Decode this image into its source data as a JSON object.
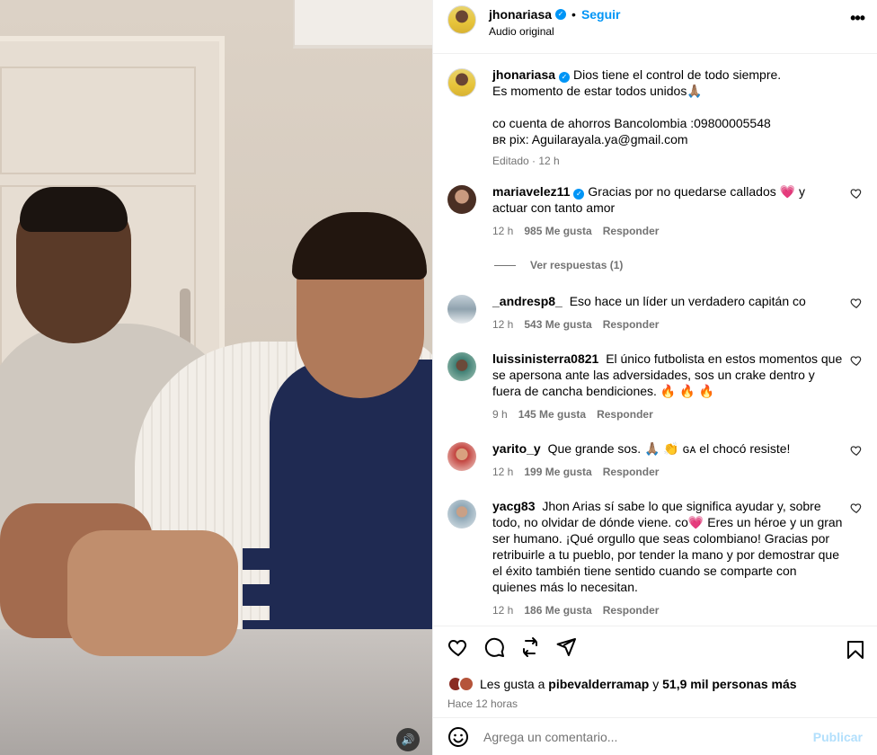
{
  "header": {
    "username": "jhonariasa",
    "separator": "•",
    "follow_label": "Seguir",
    "audio_label": "Audio original",
    "more_label": "•••"
  },
  "caption": {
    "username": "jhonariasa",
    "lines": [
      "Dios tiene el control de todo siempre.",
      "Es momento de estar todos unidos🙏🏽",
      "",
      "co cuenta de ahorros Bancolombia :09800005548",
      "ʙʀ pix: Aguilarayala.ya@gmail.com"
    ],
    "meta": "Editado · 12 h"
  },
  "comments": [
    {
      "username": "mariavelez11",
      "verified": true,
      "text": "Gracias por no quedarse callados 💗 y actuar con tanto amor",
      "time": "12 h",
      "likes": "985 Me gusta",
      "reply": "Responder",
      "view_replies": "Ver respuestas (1)",
      "avatar_color": "#6b4a3a"
    },
    {
      "username": "_andresp8_",
      "verified": false,
      "text": "Eso hace un líder un verdadero capitán co",
      "time": "12 h",
      "likes": "543 Me gusta",
      "reply": "Responder",
      "avatar_color": "#9fb3c2"
    },
    {
      "username": "luissinisterra0821",
      "verified": false,
      "text": "El único futbolista en estos momentos que se apersona ante las adversidades, sos un crake dentro y fuera de cancha bendiciones. 🔥 🔥 🔥",
      "time": "9 h",
      "likes": "145 Me gusta",
      "reply": "Responder",
      "avatar_color": "#3f7f74"
    },
    {
      "username": "yarito_y",
      "verified": false,
      "text": "Que grande sos. 🙏🏽 👏 ɢᴀ el chocó resiste!",
      "time": "12 h",
      "likes": "199 Me gusta",
      "reply": "Responder",
      "avatar_color": "#c2423d"
    },
    {
      "username": "yacg83",
      "verified": false,
      "text": "Jhon Arias sí sabe lo que significa ayudar y, sobre todo, no olvidar de dónde viene. co💗 Eres un héroe y un gran ser humano. ¡Qué orgullo que seas colombiano! Gracias por retribuirle a tu pueblo, por tender la mano y por demostrar que el éxito también tiene sentido cuando se comparte con quienes más lo necesitan.",
      "time": "12 h",
      "likes": "186 Me gusta",
      "reply": "Responder",
      "avatar_color": "#8ea7b6"
    }
  ],
  "likes": {
    "prefix": "Les gusta a",
    "user": "pibevalderramap",
    "middle": "y",
    "others": "51,9 mil personas más"
  },
  "time_ago": "Hace 12 horas",
  "comment_box": {
    "placeholder": "Agrega un comentario...",
    "publish_label": "Publicar"
  },
  "colors": {
    "accent": "#0095f6",
    "muted": "#737373",
    "publish_disabled": "#b2dffc"
  }
}
